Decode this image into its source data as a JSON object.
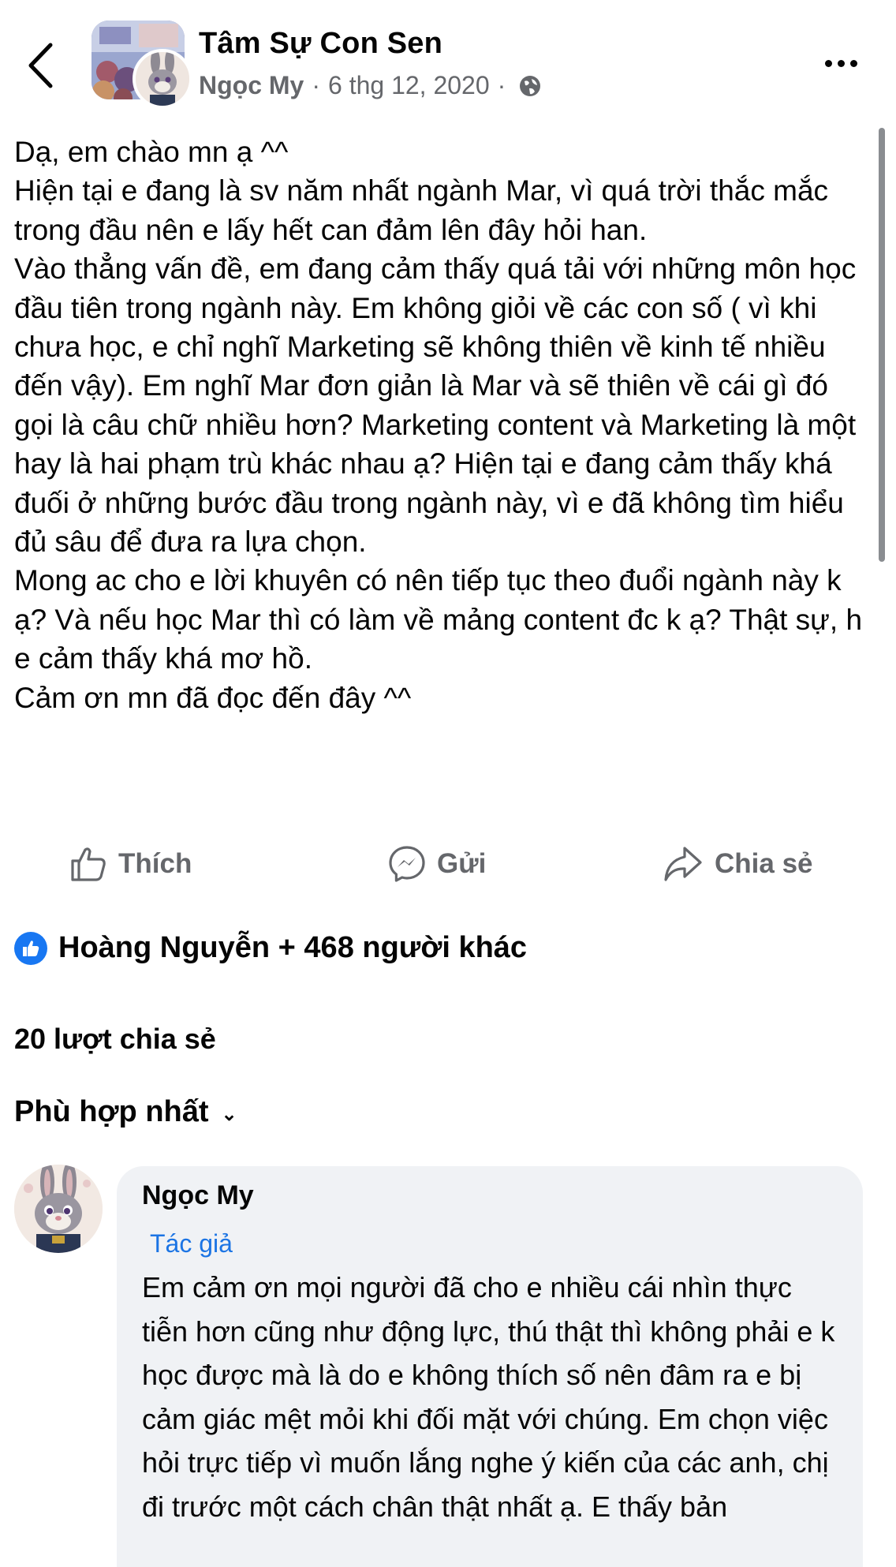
{
  "header": {
    "back_icon": "chevron-left-icon",
    "group_name": "Tâm Sự Con Sen",
    "author": "Ngọc My",
    "separator": "·",
    "date": "6 thg 12, 2020",
    "privacy_icon": "globe-icon",
    "more_icon": "more-horizontal-icon"
  },
  "post": {
    "lines": [
      "Dạ, em chào mn ạ ^^",
      "Hiện tại e đang là sv năm nhất ngành Mar, vì quá trời thắc mắc trong đầu nên e lấy hết can đảm lên đây hỏi han.",
      "Vào thẳng vấn đề, em đang cảm thấy quá tải với những môn học đầu tiên trong ngành này. Em không giỏi về các con số ( vì khi chưa học, e chỉ nghĩ Marketing sẽ không thiên về kinh tế nhiều đến vậy). Em nghĩ Mar đơn giản là Mar và sẽ thiên về cái gì đó gọi là câu chữ nhiều hơn? Marketing content và Marketing là một hay là hai phạm trù khác nhau ạ? Hiện tại e đang cảm thấy khá đuối ở những bước đầu trong ngành này, vì e đã không tìm hiểu đủ sâu để đưa ra lựa chọn.",
      "Mong ac cho e lời khuyên có nên tiếp tục theo đuổi ngành này k ạ? Và nếu học Mar thì có làm về mảng content đc k ạ? Thật sự, h e cảm thấy khá mơ hồ.",
      "Cảm ơn mn đã đọc đến đây ^^"
    ]
  },
  "actions": {
    "like_label": "Thích",
    "send_label": "Gửi",
    "share_label": "Chia sẻ"
  },
  "reactions": {
    "text": "Hoàng Nguyễn + 468 người khác"
  },
  "shares_text": "20 lượt chia sẻ",
  "sort": {
    "selected": "Phù hợp nhất",
    "chevron": "⌄"
  },
  "comment": {
    "author": "Ngọc My",
    "badge": "Tác giả",
    "text": "Em cảm ơn mọi người đã cho e nhiều cái nhìn thực tiễn hơn cũng như động lực, thú thật thì không phải e k học được mà là do e không thích số nên đâm ra e bị cảm giác mệt mỏi khi đối mặt với chúng. Em chọn việc hỏi trực tiếp vì muốn lắng nghe ý kiến của các anh, chị đi trước một cách chân thật nhất ạ. E thấy bản"
  },
  "colors": {
    "text": "#050505",
    "secondary": "#65676b",
    "accent": "#1877f2",
    "bubble": "#f0f2f5"
  }
}
